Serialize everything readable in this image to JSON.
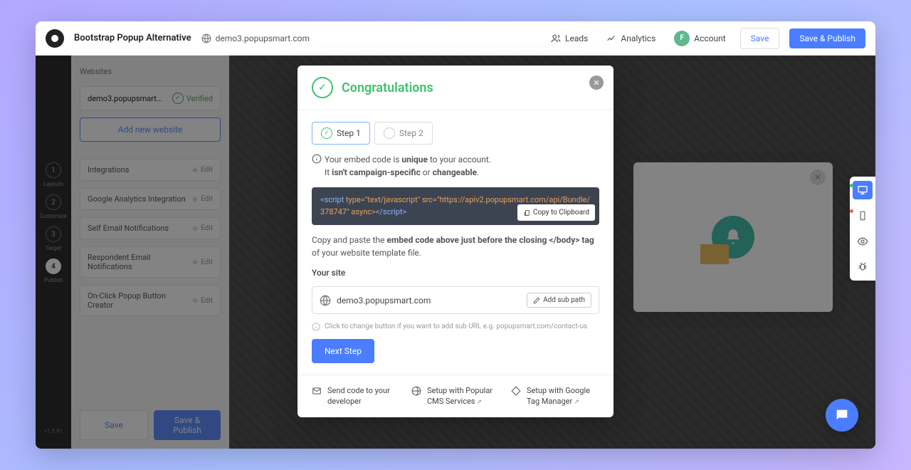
{
  "header": {
    "title": "Bootstrap Popup Alternative",
    "site_url": "demo3.popupsmart.com",
    "leads": "Leads",
    "analytics": "Analytics",
    "account": "Account",
    "avatar_letter": "F",
    "save": "Save",
    "publish": "Save & Publish"
  },
  "steps": [
    {
      "num": "1",
      "label": "Layouts"
    },
    {
      "num": "2",
      "label": "Customize"
    },
    {
      "num": "3",
      "label": "Target"
    },
    {
      "num": "4",
      "label": "Publish"
    }
  ],
  "version": "v1.5.91",
  "sidepanel": {
    "websites_title": "Websites",
    "site_name": "demo3.popupsmart...",
    "verified": "Verified",
    "add_website": "Add new website",
    "rows": [
      "Integrations",
      "Google Analytics Integration",
      "Self Email Notifications",
      "Respondent Email Notifications",
      "On-Click Popup Button Creator"
    ],
    "edit": "Edit",
    "save": "Save",
    "publish": "Save & Publish"
  },
  "modal": {
    "title": "Congratulations",
    "step1": "Step 1",
    "step2": "Step 2",
    "info_a": "Your embed code is ",
    "info_b": "unique",
    "info_c": " to your account.",
    "info_d": "It ",
    "info_e": "isn't campaign-specific",
    "info_f": " or ",
    "info_g": "changeable",
    "info_h": ".",
    "code_pre": "<script ",
    "code_attr": "type=\"text/javascript\" src=\"https://apiv2.popupsmart.com/api/Bundle/378747\" async>",
    "code_close": "</script>",
    "copy": "Copy to Clipboard",
    "paste_a": "Copy and paste the ",
    "paste_b": "embed code above just before the closing </body> tag",
    "paste_c": " of your website template file.",
    "your_site": "Your site",
    "site_value": "demo3.popupsmart.com",
    "add_sub": "Add sub path",
    "hint": "Click to change button if you want to add sub URL e.g. popupsmart.com/contact-us",
    "next": "Next Step",
    "footer": [
      "Send code to your developer",
      "Setup with Popular CMS Services",
      "Setup with Google Tag Manager"
    ]
  }
}
